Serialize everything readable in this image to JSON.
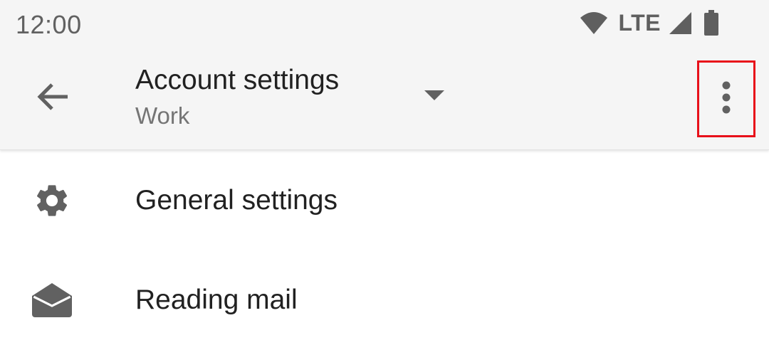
{
  "status_bar": {
    "time": "12:00",
    "network_label": "LTE",
    "icons": [
      "wifi-icon",
      "cell-signal-icon",
      "battery-icon"
    ]
  },
  "app_bar": {
    "back_icon": "arrow-back-icon",
    "title": "Account settings",
    "subtitle": "Work",
    "dropdown_icon": "arrow-drop-down-icon",
    "overflow_icon": "more-vert-icon"
  },
  "settings_list": {
    "items": [
      {
        "label": "General settings",
        "icon": "gear-icon"
      },
      {
        "label": "Reading mail",
        "icon": "open-envelope-icon"
      }
    ]
  },
  "colors": {
    "app_bar_background": "#f5f5f5",
    "primary_text": "#212121",
    "secondary_text": "#757575",
    "icon": "#616161",
    "highlight_border": "#e8101a"
  }
}
